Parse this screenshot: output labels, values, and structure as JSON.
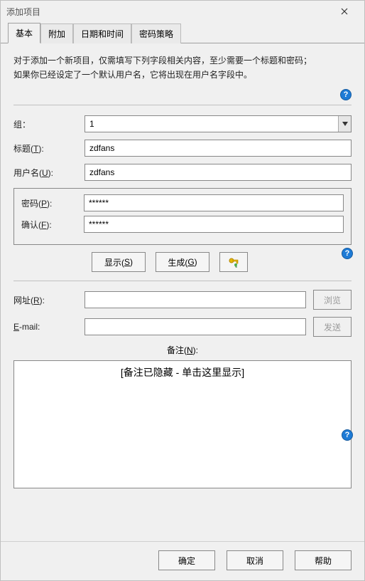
{
  "window": {
    "title": "添加项目"
  },
  "tabs": {
    "basic": "基本",
    "attach": "附加",
    "datetime": "日期和时间",
    "policy": "密码策略"
  },
  "description": {
    "line1": "对于添加一个新项目，仅需填写下列字段相关内容，至少需要一个标题和密码；",
    "line2": "如果你已经设定了一个默认用户名，它将出现在用户名字段中。"
  },
  "labels": {
    "group": "组：",
    "title_pre": "标题(",
    "title_key": "T",
    "title_post": "):",
    "user_pre": "用户名(",
    "user_key": "U",
    "user_post": "):",
    "password_pre": "密码(",
    "password_key": "P",
    "password_post": "):",
    "confirm_pre": "确认(",
    "confirm_key": "F",
    "confirm_post": "):",
    "url_pre": "网址(",
    "url_key": "R",
    "url_post": "):",
    "email_pre": "",
    "email_key": "E",
    "email_post": "-mail:",
    "remarks_pre": "备注(",
    "remarks_key": "N",
    "remarks_post": "):"
  },
  "values": {
    "group": "1",
    "title": "zdfans",
    "user": "zdfans",
    "password": "******",
    "confirm": "******",
    "url": "",
    "email": ""
  },
  "buttons": {
    "show_pre": "显示(",
    "show_key": "S",
    "show_post": ")",
    "generate_pre": "生成(",
    "generate_key": "G",
    "generate_post": ")",
    "browse": "浏览",
    "send": "发送",
    "ok": "确定",
    "cancel": "取消",
    "help": "帮助"
  },
  "remarks": {
    "placeholder": "[备注已隐藏 - 单击这里显示]"
  },
  "help": "?"
}
